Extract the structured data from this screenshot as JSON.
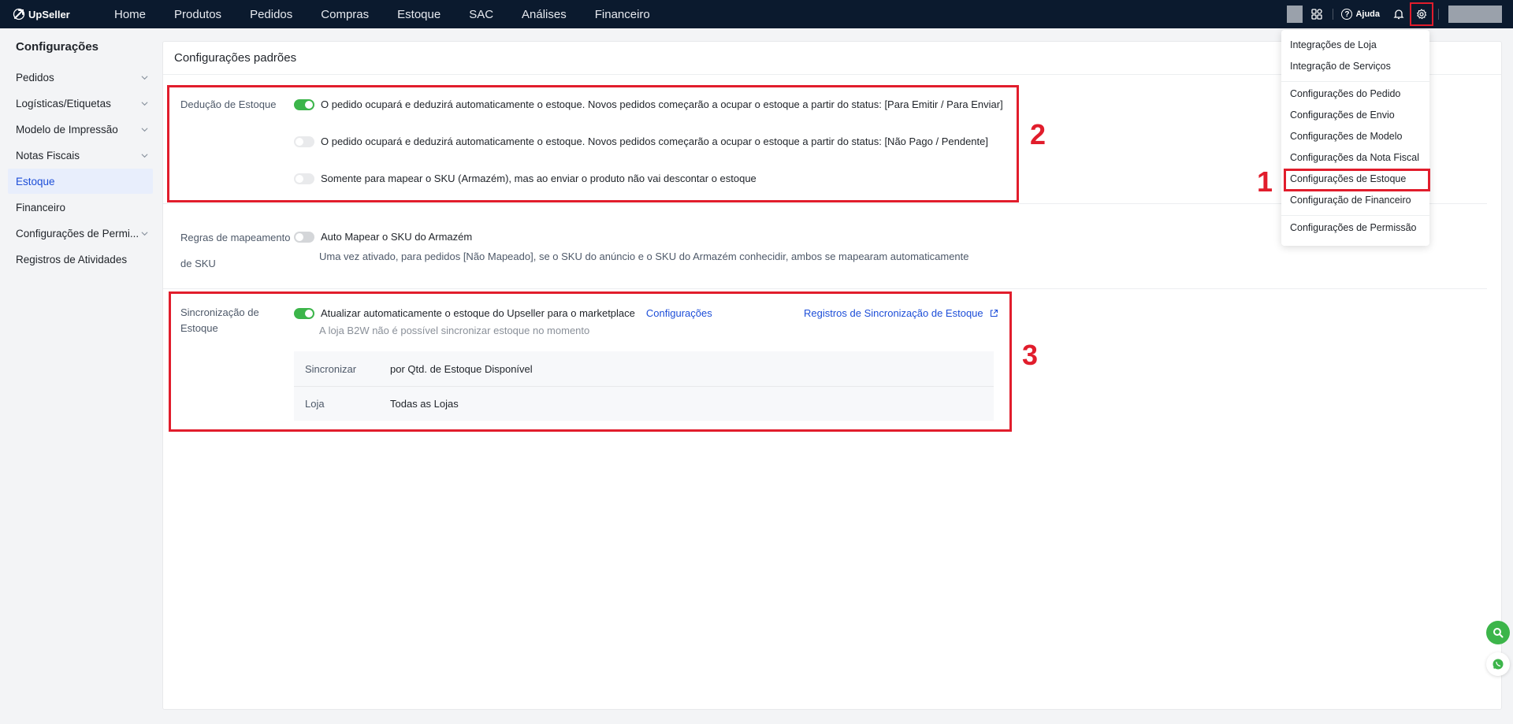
{
  "brand": "UpSeller",
  "nav": [
    "Home",
    "Produtos",
    "Pedidos",
    "Compras",
    "Estoque",
    "SAC",
    "Análises",
    "Financeiro"
  ],
  "topbar": {
    "help_label": "Ajuda"
  },
  "sidebar": {
    "title": "Configurações",
    "items": [
      {
        "label": "Pedidos",
        "expandable": true
      },
      {
        "label": "Logísticas/Etiquetas",
        "expandable": true
      },
      {
        "label": "Modelo de Impressão",
        "expandable": true
      },
      {
        "label": "Notas Fiscais",
        "expandable": true
      },
      {
        "label": "Estoque",
        "expandable": false,
        "active": true
      },
      {
        "label": "Financeiro",
        "expandable": false
      },
      {
        "label": "Configurações de Permi...",
        "expandable": true
      },
      {
        "label": "Registros de Atividades",
        "expandable": false
      }
    ]
  },
  "main": {
    "title": "Configurações padrões",
    "deduction": {
      "label": "Dedução de Estoque",
      "options": [
        {
          "text": "O pedido ocupará e deduzirá automaticamente o estoque. Novos pedidos começarão a ocupar o estoque a partir do status: [Para Emitir / Para Enviar]",
          "state": "on"
        },
        {
          "text": "O pedido ocupará e deduzirá automaticamente o estoque. Novos pedidos começarão a ocupar o estoque a partir do status: [Não Pago / Pendente]",
          "state": "disabled"
        },
        {
          "text": "Somente para mapear o SKU (Armazém), mas ao enviar o produto não vai descontar o estoque",
          "state": "disabled"
        }
      ]
    },
    "mapping": {
      "label_line1": "Regras de mapeamento",
      "label_line2": "de SKU",
      "option": "Auto Mapear o SKU do Armazém",
      "state": "off",
      "description": "Uma vez ativado, para pedidos [Não Mapeado], se o SKU do anúncio e o SKU do Armazém conhecidir, ambos se mapearam automaticamente"
    },
    "sync": {
      "label_line1": "Sincronização de",
      "label_line2": "Estoque",
      "option": "Atualizar automaticamente o estoque do Upseller para o marketplace",
      "state": "on",
      "settings_link": "Configurações",
      "logs_link": "Registros de Sincronização de Estoque",
      "hint": "A loja B2W não é possível sincronizar estoque no momento",
      "table": [
        {
          "key": "Sincronizar",
          "value": "por Qtd. de Estoque Disponível"
        },
        {
          "key": "Loja",
          "value": "Todas as Lojas"
        }
      ]
    }
  },
  "dropdown": {
    "group1": [
      "Integrações de Loja",
      "Integração de Serviços"
    ],
    "group2": [
      "Configurações do Pedido",
      "Configurações de Envio",
      "Configurações de Modelo",
      "Configurações da Nota Fiscal",
      "Configurações de Estoque",
      "Configuração de Financeiro"
    ],
    "group3": [
      "Configurações de Permissão"
    ]
  },
  "annotations": [
    "1",
    "2",
    "3"
  ],
  "colors": {
    "topbar": "#0b1a2e",
    "accent": "#1d4ed8",
    "toggle_on": "#3cb54a",
    "annotation": "#e11d2c"
  }
}
